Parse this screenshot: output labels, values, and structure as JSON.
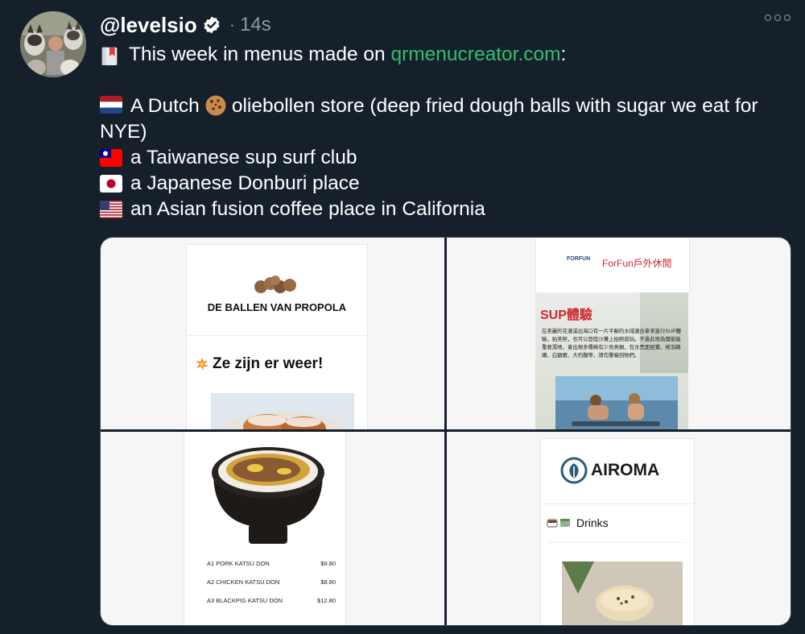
{
  "tweet": {
    "handle": "@levelsio",
    "separator": "·",
    "time": "14s",
    "intro_before": "This week in menus made on ",
    "intro_link": "qrmenucreator.com",
    "intro_after": ":",
    "line1_a": "A Dutch",
    "line1_b": "oliebollen store (deep fried dough balls with sugar we eat for NYE)",
    "line2": "a Taiwanese sup surf club",
    "line3": "a Japanese Donburi place",
    "line4": "an Asian fusion coffee place in California"
  },
  "media": {
    "dutch": {
      "title": "DE BALLEN VAN PROPOLA",
      "subtitle": "Ze zijn er weer!"
    },
    "taiwan": {
      "logo_text": "FORFUN",
      "brand": "ForFun戶外休閒",
      "heading": "SUP體驗",
      "body": "在美麗的花蓮溪出海口有一片平靜的水域適合拿來進行SUP體驗，拍美照，也可以登陸沙灘上拍照遊玩。不過此地為國家級重要濕地，會出現多種稀有少見鳥類，包含黑面琵鷺、搖羽鵜鶘、白額雁、大杓鷸等，請勿驚嚇到牠們。"
    },
    "donburi": {
      "items": [
        {
          "name": "A1 PORK KATSU DON",
          "price": "$9.80"
        },
        {
          "name": "A2 CHICKEN KATSU DON",
          "price": "$8.80"
        },
        {
          "name": "A3 BLACKPIG KATSU DON",
          "price": "$12.80"
        }
      ]
    },
    "airoma": {
      "brand": "AIROMA",
      "section": "Drinks"
    }
  },
  "colors": {
    "background": "#15202b",
    "link": "#2fbf71",
    "muted": "#8899a6",
    "taiwan_red": "#d0282e"
  }
}
